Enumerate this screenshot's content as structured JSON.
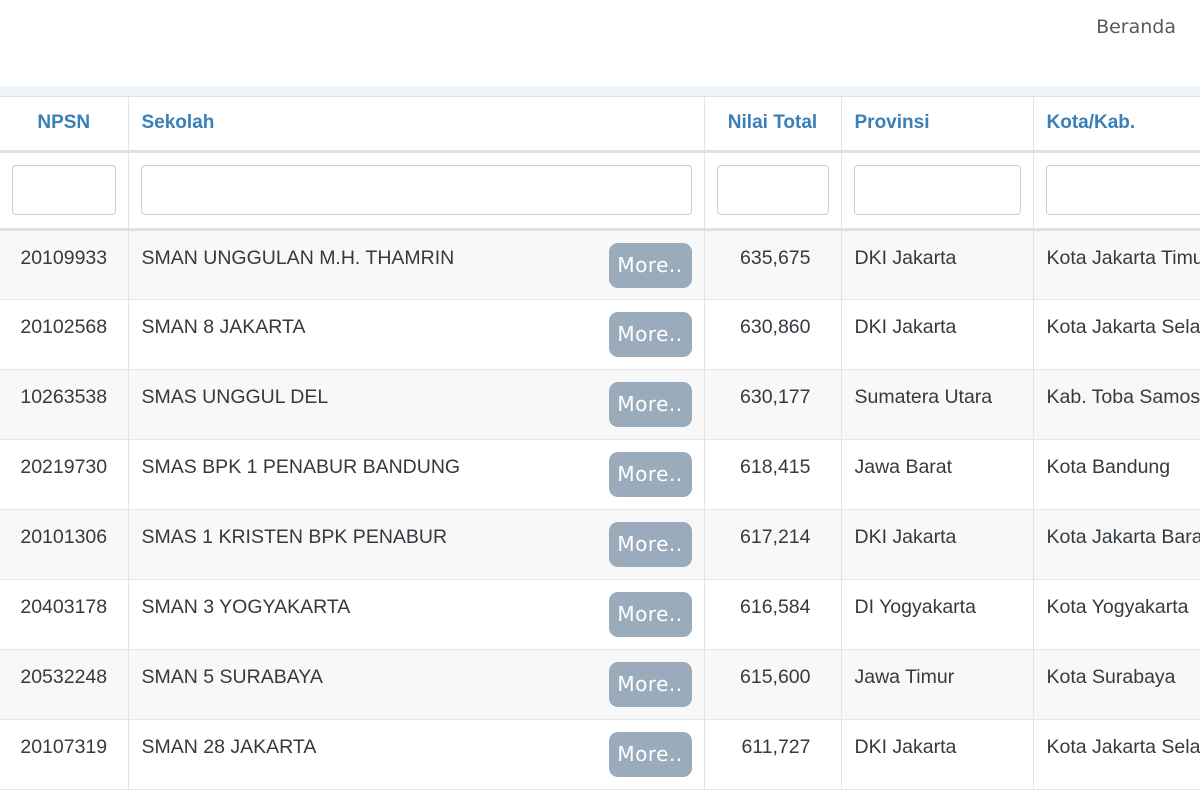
{
  "nav": {
    "home_label": "Beranda"
  },
  "table": {
    "headers": {
      "npsn": "NPSN",
      "sekolah": "Sekolah",
      "nilai": "Nilai Total",
      "provinsi": "Provinsi",
      "kota": "Kota/Kab."
    },
    "filters": {
      "npsn": "",
      "sekolah": "",
      "nilai": "",
      "provinsi": "",
      "kota": ""
    },
    "more_label": "More..",
    "rows": [
      {
        "npsn": "20109933",
        "sekolah": "SMAN UNGGULAN M.H. THAMRIN",
        "nilai": "635,675",
        "provinsi": "DKI Jakarta",
        "kota": "Kota Jakarta Timur"
      },
      {
        "npsn": "20102568",
        "sekolah": "SMAN 8 JAKARTA",
        "nilai": "630,860",
        "provinsi": "DKI Jakarta",
        "kota": "Kota Jakarta Selatan"
      },
      {
        "npsn": "10263538",
        "sekolah": "SMAS UNGGUL DEL",
        "nilai": "630,177",
        "provinsi": "Sumatera Utara",
        "kota": "Kab. Toba Samosir"
      },
      {
        "npsn": "20219730",
        "sekolah": "SMAS BPK 1 PENABUR BANDUNG",
        "nilai": "618,415",
        "provinsi": "Jawa Barat",
        "kota": "Kota Bandung"
      },
      {
        "npsn": "20101306",
        "sekolah": "SMAS 1 KRISTEN BPK PENABUR",
        "nilai": "617,214",
        "provinsi": "DKI Jakarta",
        "kota": "Kota Jakarta Barat"
      },
      {
        "npsn": "20403178",
        "sekolah": "SMAN 3 YOGYAKARTA",
        "nilai": "616,584",
        "provinsi": "DI Yogyakarta",
        "kota": "Kota Yogyakarta"
      },
      {
        "npsn": "20532248",
        "sekolah": "SMAN 5 SURABAYA",
        "nilai": "615,600",
        "provinsi": "Jawa Timur",
        "kota": "Kota Surabaya"
      },
      {
        "npsn": "20107319",
        "sekolah": "SMAN 28 JAKARTA",
        "nilai": "611,727",
        "provinsi": "DKI Jakarta",
        "kota": "Kota Jakarta Selatan"
      }
    ]
  }
}
